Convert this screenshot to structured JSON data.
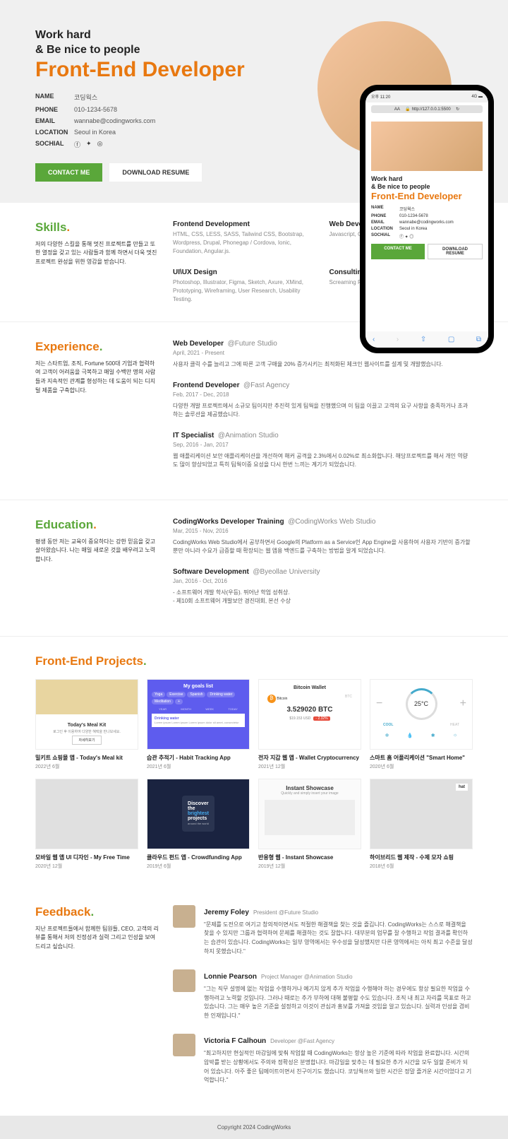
{
  "hero": {
    "line1": "Work hard",
    "line2": "& Be nice to people",
    "role": "Front-End Developer",
    "info": {
      "name_label": "NAME",
      "name": "코딩웍스",
      "phone_label": "PHONE",
      "phone": "010-1234-5678",
      "email_label": "EMAIL",
      "email": "wannabe@codingworks.com",
      "location_label": "LOCATION",
      "location": "Seoul in Korea",
      "social_label": "SOCHIAL"
    },
    "btn_contact": "CONTACT ME",
    "btn_resume": "DOWNLOAD RESUME"
  },
  "phone": {
    "time": "오후 11:20",
    "signal": "4G",
    "aa": "AA",
    "url": "http://127.0.0.1:5500",
    "refresh": "↻"
  },
  "skills": {
    "title": "Skills",
    "desc": "저의 다양한 스킬을 통해 멋진 프로젝트를 만들고 또한 열정을 갖고 있는 사람들과 함께 하면서 더욱 멋진 프로젝트 완성을 위한 영감을 받습니다.",
    "items": [
      {
        "title": "Frontend Development",
        "desc": "HTML, CSS, LESS, SASS, Tailwind CSS, Bootstrap, Wordpress, Drupal, Phonegap / Cordova, Ionic, Foundation, Angular.js."
      },
      {
        "title": "Web Development",
        "desc": "Javascript, Coffee script, Node.js, Mongo"
      },
      {
        "title": "UI\\UX Design",
        "desc": "Photoshop, Illustrator, Figma, Sketch, Axure, XMind, Prototyping, Wireframing, User Research, Usability Testing."
      },
      {
        "title": "Consulting &",
        "desc": "Screaming Frog\nMoz, WebCEO,\nCrazyEgg."
      }
    ]
  },
  "experience": {
    "title": "Experience",
    "desc": "저는 스타트업, 조직, Fortune 500대 기업과 협력하여 고객이 어려움을 극복하고 매일 수백만 명의 사람들과 지속적인 관계를 형성하는 데 도움이 되는 디지털 제품을 구축합니다.",
    "items": [
      {
        "role": "Web Developer",
        "company": "@Future Studio",
        "date": "April, 2021 - Present",
        "desc": "사용자 클릭 수를 늘리고 그에 따른 고객 구매율 20% 증가시키는 최적화된 체크인 웹사이트를 설계 및 개발했습니다."
      },
      {
        "role": "Frontend Developer",
        "company": "@Fast Agency",
        "date": "Feb, 2017 - Dec, 2018",
        "desc": "다양한 개발 프로젝트에서 소규모 팀이지만 추진력 있게 팀웍을 진행했으며 이 팀을 이끌고 고객의 요구 사항을 충족하거나 초과하는 솔루션을 제공했습니다."
      },
      {
        "role": "IT Specialist",
        "company": "@Animation Studio",
        "date": "Sep, 2016 - Jan, 2017",
        "desc": "웹 애플리케이션 보안 애플리케이션을 개선하여 해커 공격을 2.3%에서 0.02%로 최소화합니다. 해당프로젝트를 해서 개인 역량도 많이 향상되었고 특히 팀웍이중 요성을 다시 한번 느끼는 계기가 되었습니다."
      }
    ]
  },
  "education": {
    "title": "Education",
    "desc": "평생 동안 저는 교육이 중요하다는 강한 믿음을 갖고 살아왔습니다. 나는 매일 새로운 것을 배우려고 노력합니다.",
    "items": [
      {
        "role": "CodingWorks Developer Training",
        "company": "@CodingWorks Web Studio",
        "date": "Mar, 2015 - Nov, 2016",
        "desc": "CodingWorks Web Studio에서 공부하면서 Google의 Platform as a Service인 App Engine을 사용하여 사용자 기반이 증가할 뿐만 아니라 수요가 급증할 때 확장되는 웹 앱용 백엔드를 구축하는 방법을 알게 되었습니다."
      },
      {
        "role": "Software Development",
        "company": "@Byeollae University",
        "date": "Jan, 2016 - Oct, 2016",
        "desc": "- 소프트웨어 개발 학사(우등). 뛰어난 학업 성취상.\n- 제10회 소프트웨어 개발보안 경진대회, 본선 수상"
      }
    ]
  },
  "projects": {
    "title": "Front-End Projects",
    "items": [
      {
        "name": "밀키트 쇼핑몰 앱 - Today's Meal kit",
        "date": "2022년 6월"
      },
      {
        "name": "습관 추적기 - Habit Tracking App",
        "date": "2021년 6월"
      },
      {
        "name": "전자 지갑 웹 앱 - Wallet Cryptocurrency",
        "date": "2021년 12월"
      },
      {
        "name": "스마트 홈 어플리케이션 \"Smart Home\"",
        "date": "2020년 6월"
      },
      {
        "name": "모바일 웹 앱 UI 디자인 - My Free Time",
        "date": "2020년 12월"
      },
      {
        "name": "클라우드 펀드 앱 - Crowdfunding App",
        "date": "2019년 6월"
      },
      {
        "name": "반응형 웹 - Instant Showcase",
        "date": "2019년 12월"
      },
      {
        "name": "하이브리드 웹 제작 - 수제 모자 쇼핑",
        "date": "2018년 6월"
      }
    ]
  },
  "mockup": {
    "p1_title": "Today's Meal Kit",
    "p1_sub": "로그인 후 이용하여 다양한 혜택을 만나보세요.",
    "p1_btn": "자세히보기",
    "p2_title": "My goals list",
    "p2_tags": [
      "Yoga",
      "Exercise",
      "Spanish",
      "Drinking water",
      "Meditation",
      "+"
    ],
    "p2_tabs": [
      "YEAR",
      "MONTH",
      "WEEK",
      "TODAY"
    ],
    "p2_dw": "Drinking water",
    "p2_dt": "Lorem ipsum Lorem ipsum Lorem ipsum dolor sit amet, consectetur",
    "p3_title": "Bitcoin Wallet",
    "p3_bitcoin": "Bitcoin",
    "p3_btc_sym": "BTC",
    "p3_val": "3.529020 BTC",
    "p3_usd": "$19.153 USD",
    "p3_pct": "- 2.32%",
    "p4_temp": "25°C",
    "p4_minus": "−",
    "p4_plus": "+",
    "p4_cool": "COOL",
    "p4_heat": "HEAT",
    "p6_line1": "Discover",
    "p6_line2": "the",
    "p6_line3": "brightest",
    "p6_line4": "projects",
    "p6_sub": "around the world",
    "p7_title": "Instant Showcase",
    "p7_sub": "Quickly and simply insert your image",
    "p8_hat": "hat"
  },
  "feedback": {
    "title": "Feedback",
    "desc": "지난 프로젝트들에서 함께한 팀원들, CEO, 고객의 리뷰를 통해서 저의 진정성과 실력 그리고 인성을 보여드리고 싶습니다.",
    "items": [
      {
        "name": "Jeremy Foley",
        "role": "President @Future Studio",
        "text": "\"문제를 도전으로 여기고 창의적이면서도 적절한 해결책을 찾는 것을 즐깁니다. CodingWorks는 스스로 해결책을 찾을 수 있지만 그룹과 협력하여 문제를 해결하는 것도 잘합니다. 대부분의 업무를 잘 수행하고 작업 결과를 확인하는 습관이 있습니다. CodingWorks는 일부 영역에서는 우수성을 달성했지만 다른 영역에서는 아직 최고 수준을 달성하지 못했습니다.\""
      },
      {
        "name": "Lonnie Pearson",
        "role": "Project Manager @Animation Studio",
        "text": "\"그는 직무 설명에 없는 작업을 수행하거나 예기치 않게 추가 작업을 수행해야 하는 경우에도 항상 필요한 작업을 수행하려고 노력할 것입니다. 그러나 때로는 추가 부하에 대해 불평할 수도 있습니다. 조직 내 최고 자리를 목표로 하고 있습니다. 그는 매우 높은 기준을 설정하고 이것이 관심과 홍보를 가져올 것임을 알고 있습니다. 실력과 인성을 겸비한 인재입니다.\""
      },
      {
        "name": "Victoria F Calhoun",
        "role": "Developer @Fast Agency",
        "text": "\"최고하지만 현실적인 마감일에 맞춰 작업할 때 CodingWorks는 항상 높은 기준에 따라 작업을 완료합니다. 시간의 압박를 받는 상황에서도 주의와 정확성은 분명합니다. 마감일을 맞추는 데 필요한 추가 시간을 모두 일할 준비가 되어 있습니다. 아주 좋은 팀메이트이면서 친구이기도 했습니다. 코딩웍쓰와 일한 시간은 정말 즐거운 시간이었다고 기억합니다.\""
      }
    ]
  },
  "footer": "Copyright 2024 CodingWorks"
}
